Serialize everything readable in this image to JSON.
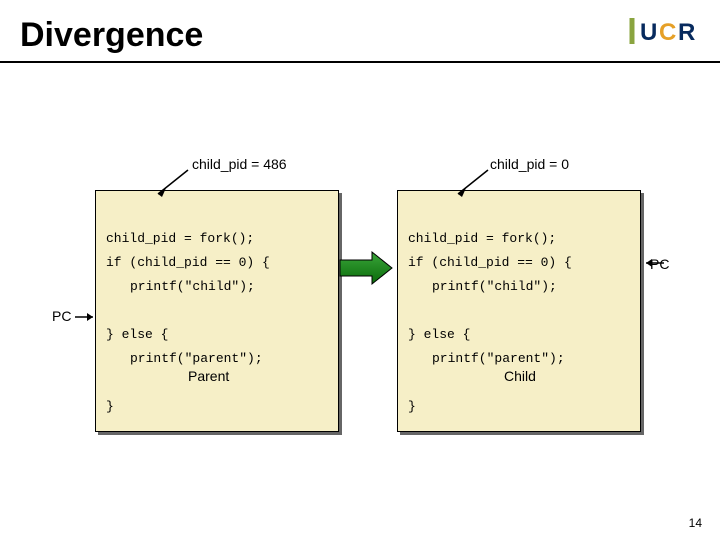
{
  "title": "Divergence",
  "logo": {
    "u": "U",
    "c": "C",
    "r": "R"
  },
  "slide_number": "14",
  "left": {
    "label": "child_pid = 486",
    "caption": "Parent",
    "code": {
      "l1": "child_pid = fork();",
      "l2": "if (child_pid == 0) {",
      "l3": "printf(\"child\");",
      "l4": "} else {",
      "l5": "printf(\"parent\");",
      "l6": "}"
    }
  },
  "right": {
    "label": "child_pid = 0",
    "caption": "Child",
    "code": {
      "l1": "child_pid = fork();",
      "l2": "if (child_pid == 0) {",
      "l3": "printf(\"child\");",
      "l4": "} else {",
      "l5": "printf(\"parent\");",
      "l6": "}"
    }
  },
  "pc_left_label": "PC",
  "pc_right_label": "PC"
}
